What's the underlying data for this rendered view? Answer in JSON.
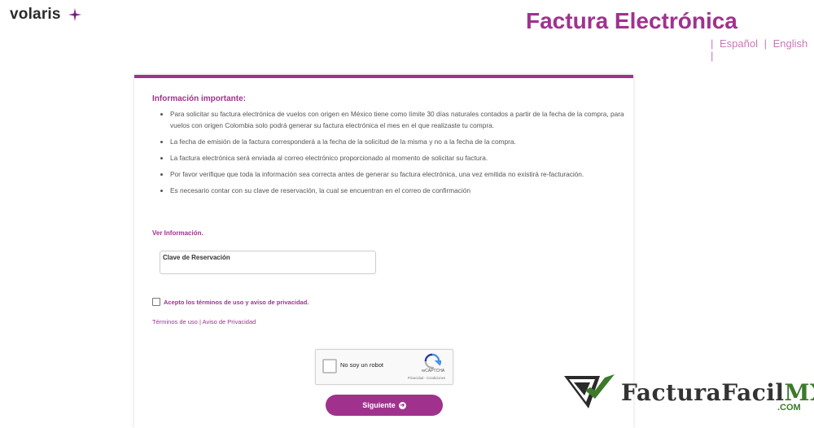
{
  "header": {
    "brand": "volaris",
    "title": "Factura Electrónica",
    "languages": [
      "Español",
      "English"
    ],
    "separator": "|"
  },
  "card": {
    "info_title": "Información importante:",
    "info_items": [
      "Para solicitar su factura electrónica de vuelos con origen en México tiene como límite 30 días naturales contados a partir de la fecha de la compra, para vuelos con origen Colombia solo podrá generar su factura electrónica el mes en el que realizaste tu compra.",
      "La fecha de emisión de la factura corresponderá a la fecha de la solicitud de la misma y no a la fecha de la compra.",
      "La factura electrónica será enviada al correo electrónico proporcionado al momento de solicitar su factura.",
      "Por favor verifique que toda la información sea correcta antes de generar su factura electrónica, una vez emitida no existirá re-facturación.",
      "Es necesario contar con su clave de reservación, la cual se encuentran en el correo de confirmación"
    ],
    "ver_informacion": "Ver Información.",
    "clave_label": "Clave de Reservación",
    "terms_label": "Acepto los términos de uso y aviso de privacidad.",
    "terms_link": "Términos de uso",
    "privacy_link": "Aviso de Privacidad",
    "link_separator": "|",
    "submit_label": "Siguiente"
  },
  "recaptcha": {
    "label": "No soy un robot",
    "brand": "reCAPTCHA",
    "links": "Privacidad - Condiciones"
  },
  "watermark": {
    "name": "FacturaFacil",
    "suffix": "MX",
    "domain": ".COM"
  },
  "colors": {
    "accent": "#a0328e",
    "lang_link": "#c878b8",
    "watermark_green": "#3c7a2a"
  }
}
